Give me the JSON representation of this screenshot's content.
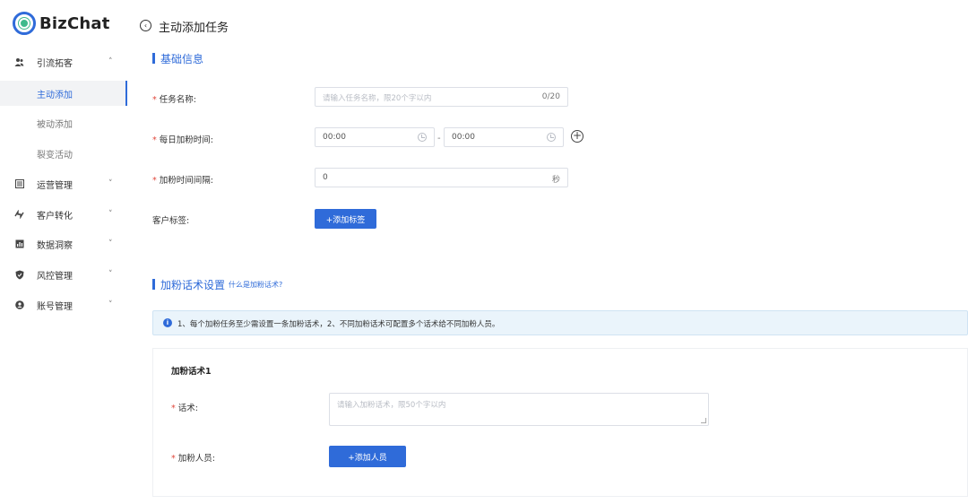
{
  "app": {
    "name": "BizChat"
  },
  "sidebar": {
    "groups": [
      {
        "label": "引流拓客",
        "icon": "users-icon",
        "chevron": "˄"
      },
      {
        "label": "运营管理",
        "icon": "document-icon",
        "chevron": "˅"
      },
      {
        "label": "客户转化",
        "icon": "convert-icon",
        "chevron": "˅"
      },
      {
        "label": "数据洞察",
        "icon": "bar-chart-icon",
        "chevron": "˅"
      },
      {
        "label": "风控管理",
        "icon": "shield-icon",
        "chevron": "˅"
      },
      {
        "label": "账号管理",
        "icon": "account-icon",
        "chevron": "˅"
      }
    ],
    "sub_items": [
      {
        "label": "主动添加",
        "active": true
      },
      {
        "label": "被动添加",
        "active": false
      },
      {
        "label": "裂变活动",
        "active": false
      }
    ]
  },
  "page": {
    "back_icon": "back-arrow-icon",
    "title": "主动添加任务"
  },
  "basic_info": {
    "section_title": "基础信息",
    "task_name": {
      "label": "任务名称:",
      "required": "*",
      "placeholder": "请输入任务名称，限20个字以内",
      "counter": "0/20"
    },
    "daily_time": {
      "label": "每日加粉时间:",
      "required": "*",
      "start": "00:00",
      "end": "00:00",
      "separator": "-",
      "add_icon": "plus-circle-icon"
    },
    "interval": {
      "label": "加粉时间间隔:",
      "required": "*",
      "value": "0",
      "unit": "秒"
    },
    "tags": {
      "label": "客户标签:",
      "button": "+添加标签"
    }
  },
  "script_settings": {
    "section_title": "加粉话术设置",
    "hint": "什么是加粉话术?",
    "notice": "1、每个加粉任务至少需设置一条加粉话术，2、不同加粉话术可配置多个话术给不同加粉人员。",
    "notice_icon": "info-icon",
    "card": {
      "title": "加粉话术1",
      "script": {
        "label": "话术:",
        "required": "*",
        "placeholder": "请输入加粉话术，限50个字以内"
      },
      "staff": {
        "label": "加粉人员:",
        "required": "*",
        "button": "+添加人员"
      }
    }
  }
}
